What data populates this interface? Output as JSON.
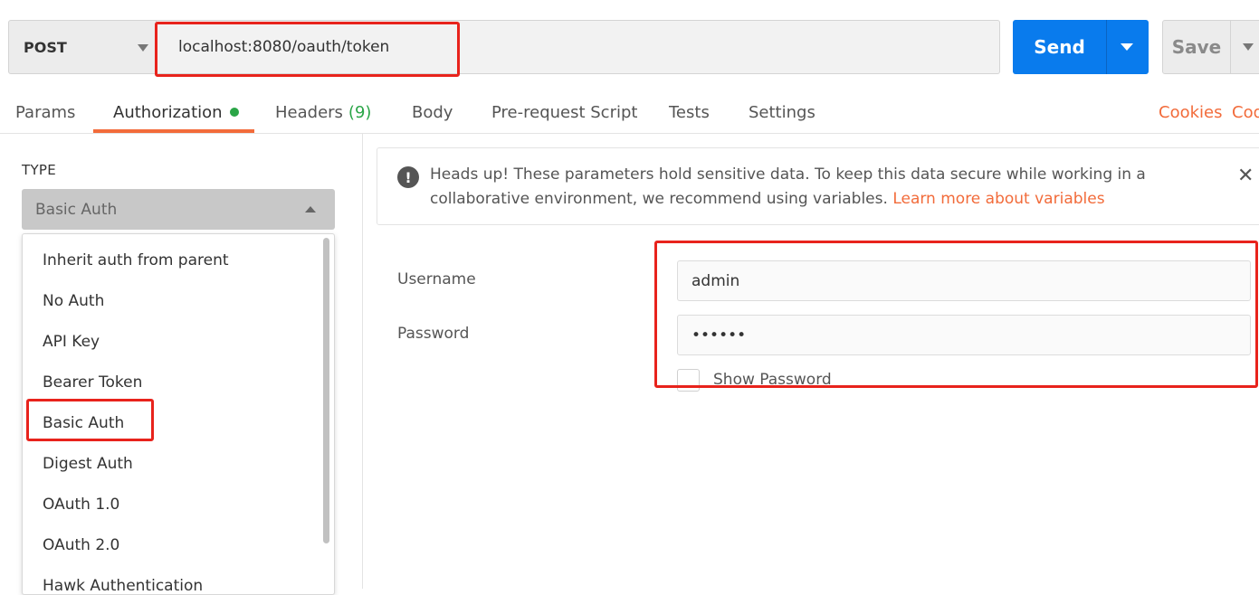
{
  "request": {
    "method": "POST",
    "url": "localhost:8080/oauth/token",
    "send_label": "Send",
    "save_label": "Save"
  },
  "tabs": [
    {
      "label": "Params"
    },
    {
      "label": "Authorization",
      "active": true,
      "has_indicator": true
    },
    {
      "label": "Headers",
      "count": "(9)"
    },
    {
      "label": "Body"
    },
    {
      "label": "Pre-request Script"
    },
    {
      "label": "Tests"
    },
    {
      "label": "Settings"
    }
  ],
  "right_links": {
    "cookies": "Cookies",
    "code": "Code"
  },
  "auth": {
    "type_label": "TYPE",
    "selected": "Basic Auth",
    "options": [
      "Inherit auth from parent",
      "No Auth",
      "API Key",
      "Bearer Token",
      "Basic Auth",
      "Digest Auth",
      "OAuth 1.0",
      "OAuth 2.0",
      "Hawk Authentication"
    ]
  },
  "alert": {
    "text": "Heads up! These parameters hold sensitive data. To keep this data secure while working in a collaborative environment, we recommend using variables.",
    "link": "Learn more about variables",
    "close": "✕"
  },
  "fields": {
    "username_label": "Username",
    "username_value": "admin",
    "password_label": "Password",
    "password_value": "••••••",
    "show_password_label": "Show Password"
  },
  "colors": {
    "accent": "#f26b3a",
    "send": "#097bed",
    "highlight": "#e8231c",
    "success": "#2aa547"
  }
}
